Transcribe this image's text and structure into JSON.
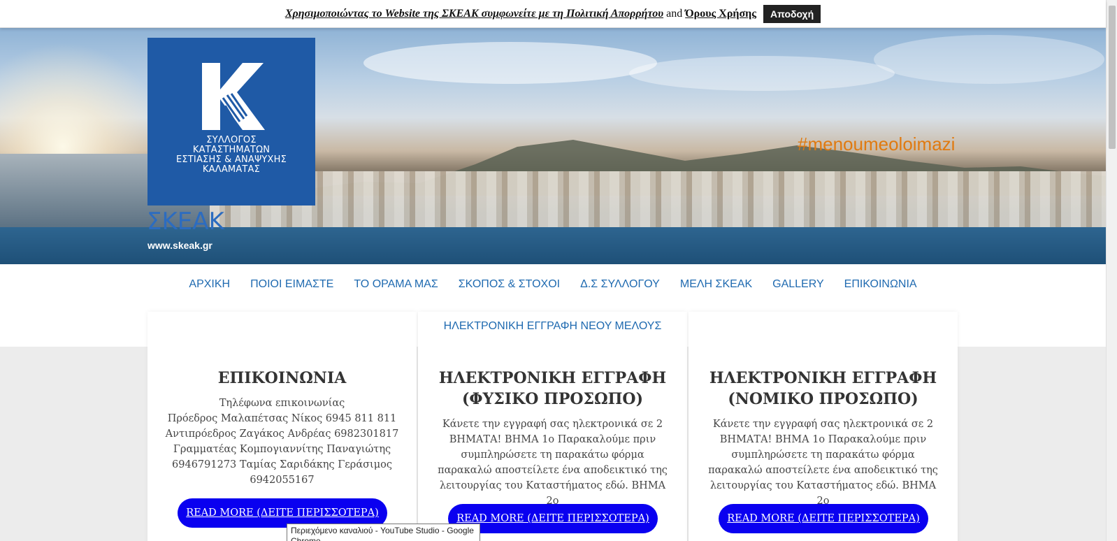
{
  "cookie": {
    "prefix": "Χρησιμοποιώντας το Website της ΣΚΕΑΚ συμφωνείτε με τη Πολιτική Απορρήτου",
    "and": "and",
    "terms": "Όρους Χρήσης",
    "accept": "Αποδοχή"
  },
  "header": {
    "logo_lines": [
      "ΣΥΛΛΟΓΟΣ",
      "ΚΑΤΑΣΤΗΜΑΤΩΝ",
      "ΕΣΤΙΑΣΗΣ & ΑΝΑΨΥΧΗΣ",
      "ΚΑΛΑΜΑΤΑΣ"
    ],
    "site_title": "ΣΚΕΑΚ",
    "tagline": "www.skeak.gr",
    "hashtag": "#menoumeoloimazi"
  },
  "nav": {
    "items": [
      {
        "label": "ΑΡΧΙΚΗ"
      },
      {
        "label": "ΠΟΙΟΙ ΕΙΜΑΣΤΕ"
      },
      {
        "label": "ΤΟ ΟΡΑΜΑ ΜΑΣ"
      },
      {
        "label": "ΣΚΟΠΟΣ & ΣΤΟΧΟΙ"
      },
      {
        "label": "Δ.Σ ΣΥΛΛΟΓΟΥ"
      },
      {
        "label": "ΜΕΛΗ ΣΚΕΑΚ"
      },
      {
        "label": "GALLERY"
      },
      {
        "label": "ΕΠΙΚΟΙΝΩΝΙΑ"
      }
    ]
  },
  "cards": [
    {
      "top": "",
      "title_lines": [
        "ΕΠΙΚΟΙΝΩΝΙΑ"
      ],
      "body_lines": [
        "Τηλέφωνα επικοινωνίας",
        "Πρόεδρος Μαλαπέτσας Νίκος 6945 811 811",
        "Αντιπρόεδρος Ζαγάκος Ανδρέας 6982301817",
        "Γραμματέας Κομπογιαννίτης Παναγιώτης",
        "6946791273 Ταμίας Σαριδάκης Γεράσιμος",
        "6942055167"
      ],
      "button": "READ MORE (ΔΕΙΤΕ ΠΕΡΙΣΣΟΤΕΡΑ)"
    },
    {
      "top": "ΗΛΕΚΤΡΟΝΙΚΗ ΕΓΓΡΑΦΗ ΝΕΟΥ ΜΕΛΟΥΣ",
      "title_lines": [
        "ΗΛΕΚΤΡΟΝΙΚΗ ΕΓΓΡΑΦΗ",
        "(ΦΥΣΙΚΟ ΠΡΟΣΩΠΟ)"
      ],
      "body_lines": [
        "Κάνετε την εγγραφή σας ηλεκτρονικά σε 2",
        "ΒΗΜΑΤΑ! ΒΗΜΑ 1ο Παρακαλούμε πριν",
        "συμπληρώσετε τη παρακάτω φόρμα",
        "παρακαλώ αποστείλετε ένα αποδεικτικό της",
        "λειτουργίας του Καταστήματος εδώ. ΒΗΜΑ 2ο"
      ],
      "button": "READ MORE (ΔΕΙΤΕ ΠΕΡΙΣΣΟΤΕΡΑ)"
    },
    {
      "top": "",
      "title_lines": [
        "ΗΛΕΚΤΡΟΝΙΚΗ ΕΓΓΡΑΦΗ",
        "(ΝΟΜΙΚΟ ΠΡΟΣΩΠΟ)"
      ],
      "body_lines": [
        "Κάνετε την εγγραφή σας ηλεκτρονικά σε 2",
        "ΒΗΜΑΤΑ! ΒΗΜΑ 1ο Παρακαλούμε πριν",
        "συμπληρώσετε τη παρακάτω φόρμα",
        "παρακαλώ αποστείλετε ένα αποδεικτικό της",
        "λειτουργίας του Καταστήματος εδώ. ΒΗΜΑ 2ο"
      ],
      "button": "READ MORE (ΔΕΙΤΕ ΠΕΡΙΣΣΟΤΕΡΑ)"
    }
  ],
  "tooltip": {
    "text": "Περιεχόμενο καναλιού - YouTube Studio - Google Chrome"
  },
  "colors": {
    "brand_blue": "#1f5aa6",
    "nav_blue": "#1f6ab0",
    "button_blue": "#0a00f0",
    "hashtag_orange": "#e07a10"
  }
}
